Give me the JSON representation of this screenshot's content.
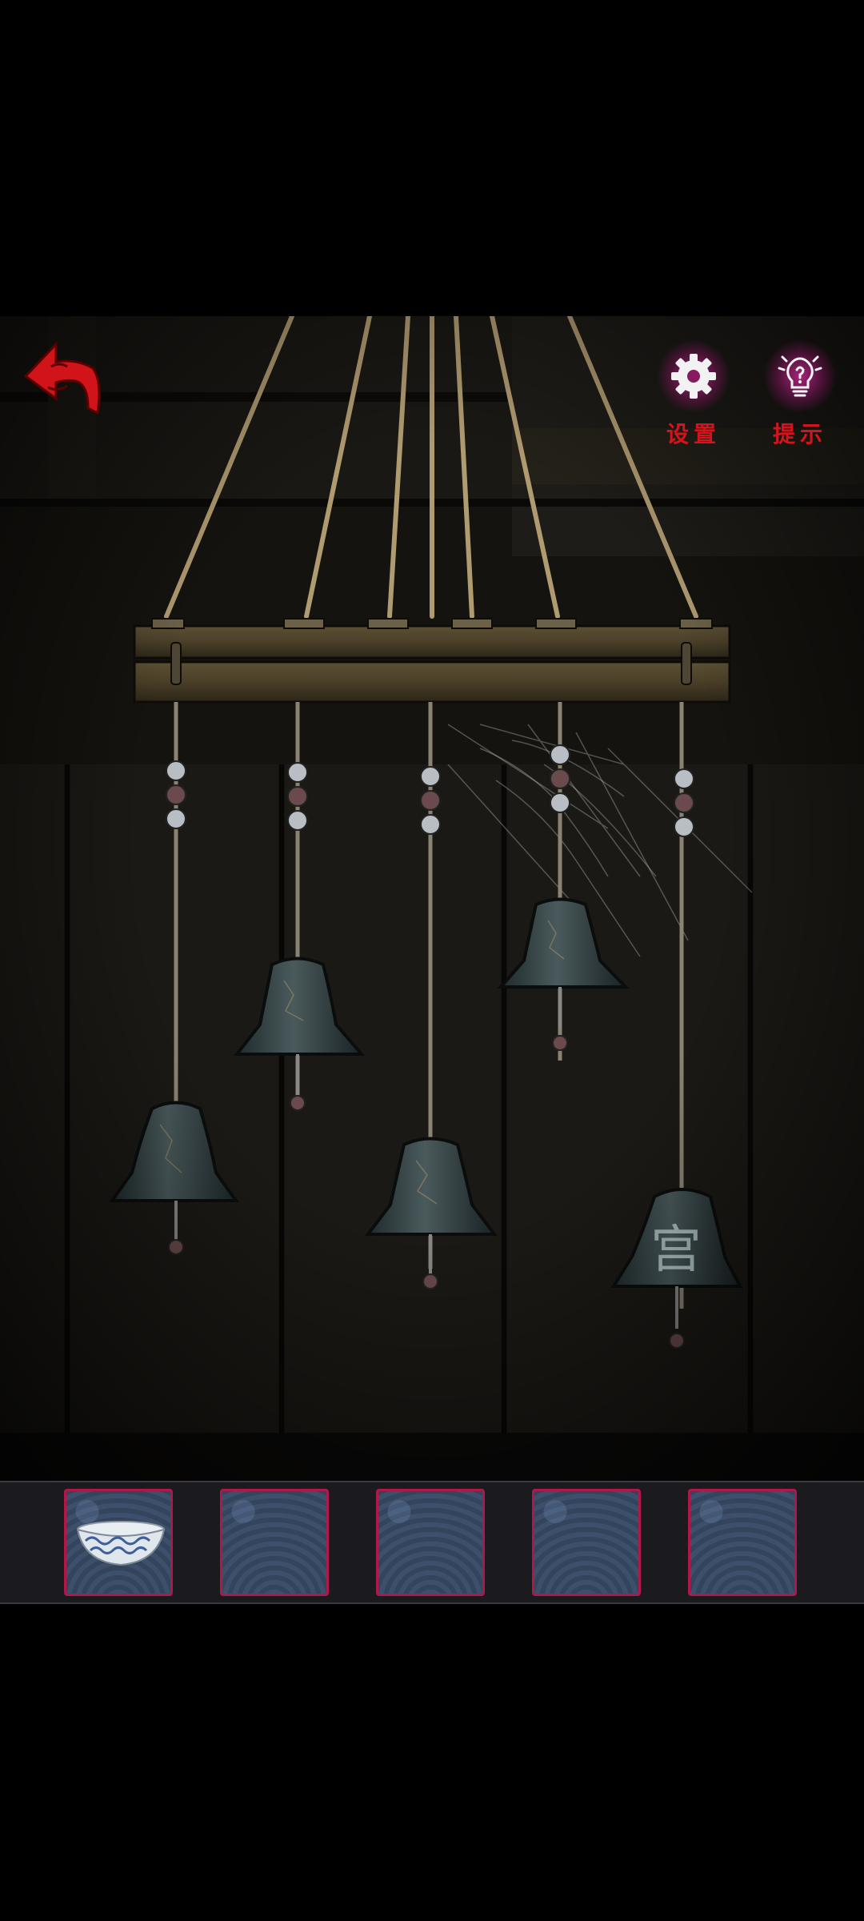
{
  "screen": "wind-chime-puzzle",
  "hud": {
    "settings": {
      "label": "设置",
      "icon": "gear-icon"
    },
    "hint": {
      "label": "提示",
      "icon": "lightbulb-icon"
    },
    "back": {
      "icon": "back-arrow-icon"
    }
  },
  "colors": {
    "hud_label": "#d2141c",
    "hud_glow": "#be288c",
    "slot_border": "#b0184a",
    "back_arrow": "#d0141a"
  },
  "bell": {
    "glyph": "宫"
  },
  "inventory": {
    "slots": [
      {
        "item": "blue-white-porcelain-bowl",
        "filled": true
      },
      {
        "item": "",
        "filled": false
      },
      {
        "item": "",
        "filled": false
      },
      {
        "item": "",
        "filled": false
      },
      {
        "item": "",
        "filled": false
      }
    ]
  }
}
